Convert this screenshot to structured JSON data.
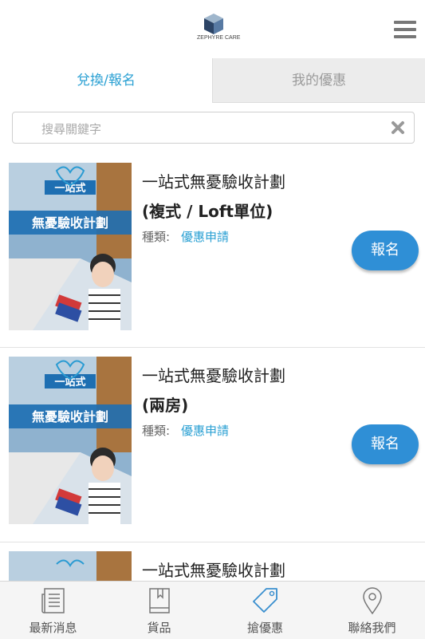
{
  "header": {
    "logo_text": "ZEPHYRE CARE",
    "menu_icon": "hamburger-icon"
  },
  "tabs": [
    {
      "label": "兌換/報名",
      "active": true
    },
    {
      "label": "我的優惠",
      "active": false
    }
  ],
  "search": {
    "placeholder": "搜尋關鍵字",
    "value": "",
    "clear_icon": "close-icon"
  },
  "items": [
    {
      "title_line1": "一站式無憂驗收計劃",
      "title_line2": "(複式 / Loft單位)",
      "type_label": "種類:",
      "type_value": "優惠申請",
      "button_label": "報名",
      "poster_heading": "一站式",
      "poster_title": "無憂驗收計劃"
    },
    {
      "title_line1": "一站式無憂驗收計劃",
      "title_line2": "(兩房)",
      "type_label": "種類:",
      "type_value": "優惠申請",
      "button_label": "報名",
      "poster_heading": "一站式",
      "poster_title": "無憂驗收計劃"
    },
    {
      "title_line1": "一站式無憂驗收計劃"
    }
  ],
  "bottom_nav": [
    {
      "label": "最新消息",
      "icon": "news-icon",
      "active": false
    },
    {
      "label": "貨品",
      "icon": "book-icon",
      "active": false
    },
    {
      "label": "搶優惠",
      "icon": "tag-icon",
      "active": true
    },
    {
      "label": "聯絡我們",
      "icon": "location-pin-icon",
      "active": false
    }
  ],
  "colors": {
    "accent": "#2aa0d3",
    "button": "#2f8fd6",
    "nav_active": "#3a8fcf"
  }
}
